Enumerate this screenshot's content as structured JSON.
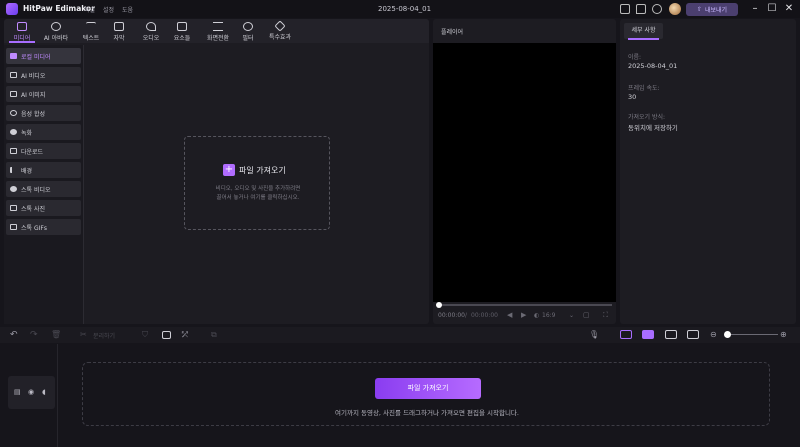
{
  "titlebar": {
    "app_name": "HitPaw Edimakor",
    "menus": [
      "파일",
      "설정",
      "도움"
    ],
    "doc_title": "2025-08-04_01",
    "export_label": "내보내기",
    "window_controls": [
      "minimize-icon",
      "maximize-icon",
      "close-icon"
    ]
  },
  "media_toolbar": {
    "tools": [
      {
        "label": "미디어",
        "icon": "media-icon",
        "active": true
      },
      {
        "label": "AI 아바타",
        "icon": "avatar-icon",
        "active": false
      },
      {
        "label": "텍스트",
        "icon": "text-icon",
        "active": false
      },
      {
        "label": "자막",
        "icon": "subtitle-icon",
        "active": false
      },
      {
        "label": "오디오",
        "icon": "music-icon",
        "active": false
      },
      {
        "label": "요소들",
        "icon": "elements-icon",
        "active": false
      },
      {
        "label": "화면전환",
        "icon": "transition-icon",
        "active": false
      },
      {
        "label": "필터",
        "icon": "filter-icon",
        "active": false
      },
      {
        "label": "특수효과",
        "icon": "effects-icon",
        "active": false
      }
    ]
  },
  "side_list": {
    "items": [
      {
        "label": "로컬 미디어",
        "icon": "folder-icon",
        "active": true
      },
      {
        "label": "AI 비디오",
        "icon": "ai-video-icon",
        "active": false
      },
      {
        "label": "AI 이미지",
        "icon": "ai-image-icon",
        "active": false
      },
      {
        "label": "음성 합성",
        "icon": "voice-icon",
        "active": false
      },
      {
        "label": "녹화",
        "icon": "record-icon",
        "active": false
      },
      {
        "label": "다운로드",
        "icon": "download-icon",
        "active": false
      },
      {
        "label": "배경",
        "icon": "background-icon",
        "active": false
      },
      {
        "label": "스톡 비디오",
        "icon": "stock-video-icon",
        "active": false
      },
      {
        "label": "스톡 사진",
        "icon": "stock-photo-icon",
        "active": false
      },
      {
        "label": "스톡 GIFs",
        "icon": "gif-icon",
        "active": false
      }
    ]
  },
  "import_box": {
    "label": "파일 가져오기",
    "hint_line1": "비디오, 오디오 및 사진을 추가하려면",
    "hint_line2": "끌어서 놓거나 여기를 클릭하십시오."
  },
  "player": {
    "title": "플레이어",
    "time_current": "00:00:00",
    "time_separator": "/",
    "time_total": "00:00:00",
    "aspect": "16:9",
    "progress": 0
  },
  "details": {
    "tab_label": "세부 사항",
    "fields": [
      {
        "key": "이름:",
        "value": "2025-08-04_01"
      },
      {
        "key": "프레임 속도:",
        "value": "30"
      },
      {
        "key": "가져오기 방식:",
        "value": "동위치에 저장하기"
      }
    ]
  },
  "timeline_toolbar": {
    "split_label": "분리하기"
  },
  "timeline": {
    "drop_button_label": "파일 가져오기",
    "drop_hint": "여기까지 동영상, 사진를 드래그하거나 가져오면 편집을 시작합니다."
  },
  "colors": {
    "accent": "#a86dff",
    "background": "#16151b",
    "panel": "#1d1c22"
  }
}
